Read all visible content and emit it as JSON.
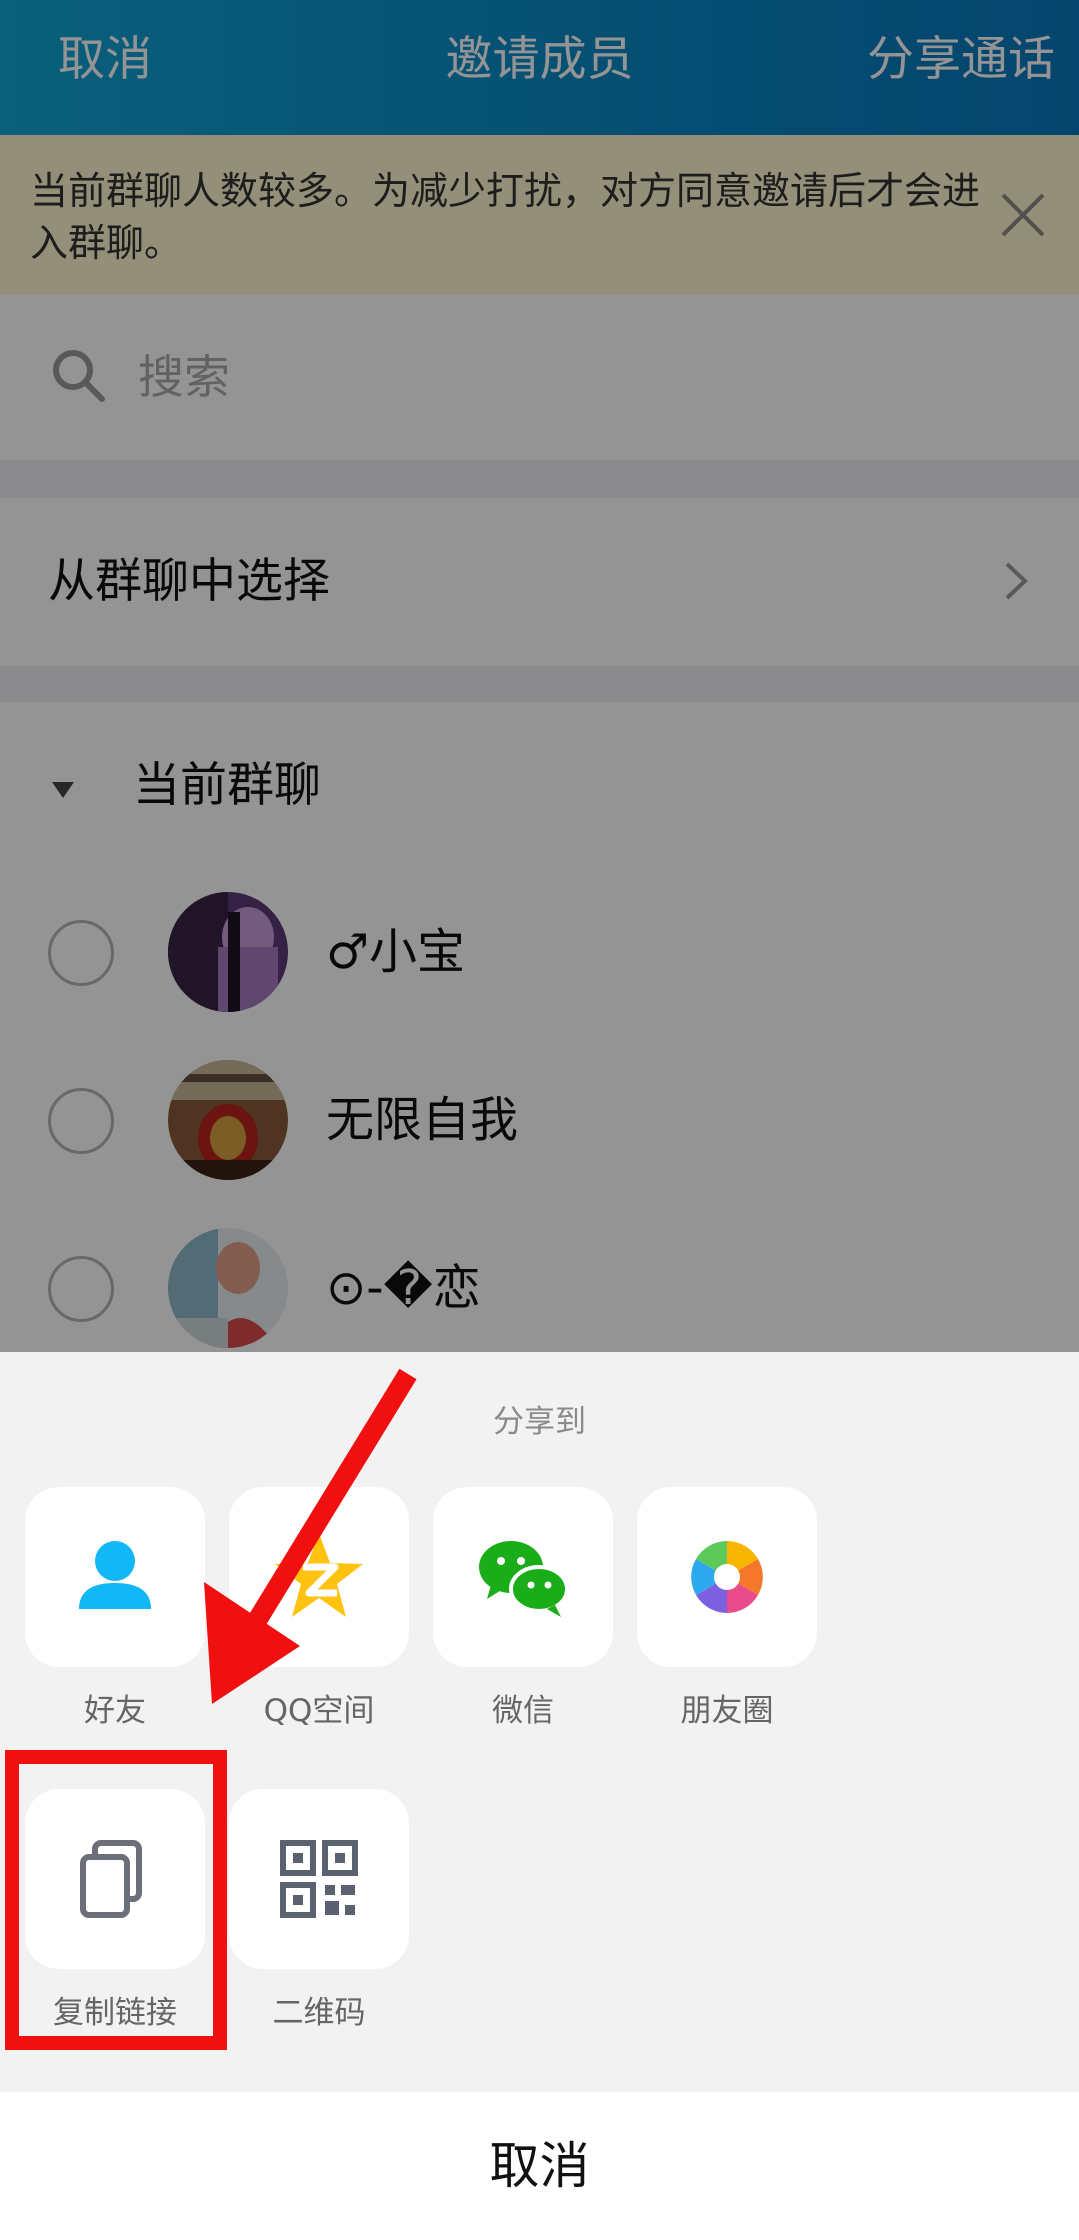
{
  "header": {
    "left_action": "取消",
    "title": "邀请成员",
    "right_action": "分享通话"
  },
  "notice": {
    "text": "当前群聊人数较多。为减少打扰，对方同意邀请后才会进入群聊。"
  },
  "search": {
    "placeholder": "搜索"
  },
  "from_group": {
    "label": "从群聊中选择"
  },
  "current_group": {
    "label": "当前群聊",
    "members": [
      {
        "name": "♂小宝"
      },
      {
        "name": "无限自我"
      },
      {
        "name": "⊙-�恋"
      }
    ]
  },
  "share_sheet": {
    "title": "分享到",
    "items": [
      {
        "label": "好友",
        "icon": "friend-icon"
      },
      {
        "label": "QQ空间",
        "icon": "qzone-star-icon"
      },
      {
        "label": "微信",
        "icon": "wechat-icon"
      },
      {
        "label": "朋友圈",
        "icon": "moments-aperture-icon"
      },
      {
        "label": "复制链接",
        "icon": "copy-link-icon"
      },
      {
        "label": "二维码",
        "icon": "qr-code-icon"
      }
    ],
    "cancel_label": "取消"
  },
  "colors": {
    "header_start": "#11a5d4",
    "header_end": "#0a78bc",
    "notice_bg": "#fff6cf",
    "highlight_red": "#f01010",
    "qq_blue": "#12b7f5",
    "wechat_green": "#1aad19"
  }
}
